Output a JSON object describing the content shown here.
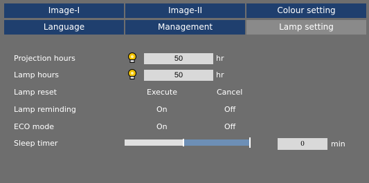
{
  "tabs_row1": [
    {
      "label": "Image-I"
    },
    {
      "label": "Image-II"
    },
    {
      "label": "Colour setting"
    }
  ],
  "tabs_row2": [
    {
      "label": "Language"
    },
    {
      "label": "Management"
    },
    {
      "label": "Lamp setting",
      "active": true
    }
  ],
  "settings": {
    "projection_hours": {
      "label": "Projection hours",
      "value": "50",
      "unit": "hr",
      "icon": "lamp-bulb-icon"
    },
    "lamp_hours": {
      "label": "Lamp hours",
      "value": "50",
      "unit": "hr",
      "icon": "lamp-bulb-icon"
    },
    "lamp_reset": {
      "label": "Lamp reset",
      "option1": "Execute",
      "option2": "Cancel"
    },
    "lamp_reminding": {
      "label": "Lamp reminding",
      "option1": "On",
      "option2": "Off"
    },
    "eco_mode": {
      "label": "ECO mode",
      "option1": "On",
      "option2": "Off"
    },
    "sleep_timer": {
      "label": "Sleep timer",
      "value": "0",
      "unit": "min",
      "slider_level": 0.47
    }
  },
  "colors": {
    "tab_blue": "#1f3f6e",
    "tab_active": "#8a8a8a",
    "panel_gray": "#6e6e6e",
    "bulb_yellow": "#f2c200",
    "slider_blue": "#6d8fb6"
  }
}
